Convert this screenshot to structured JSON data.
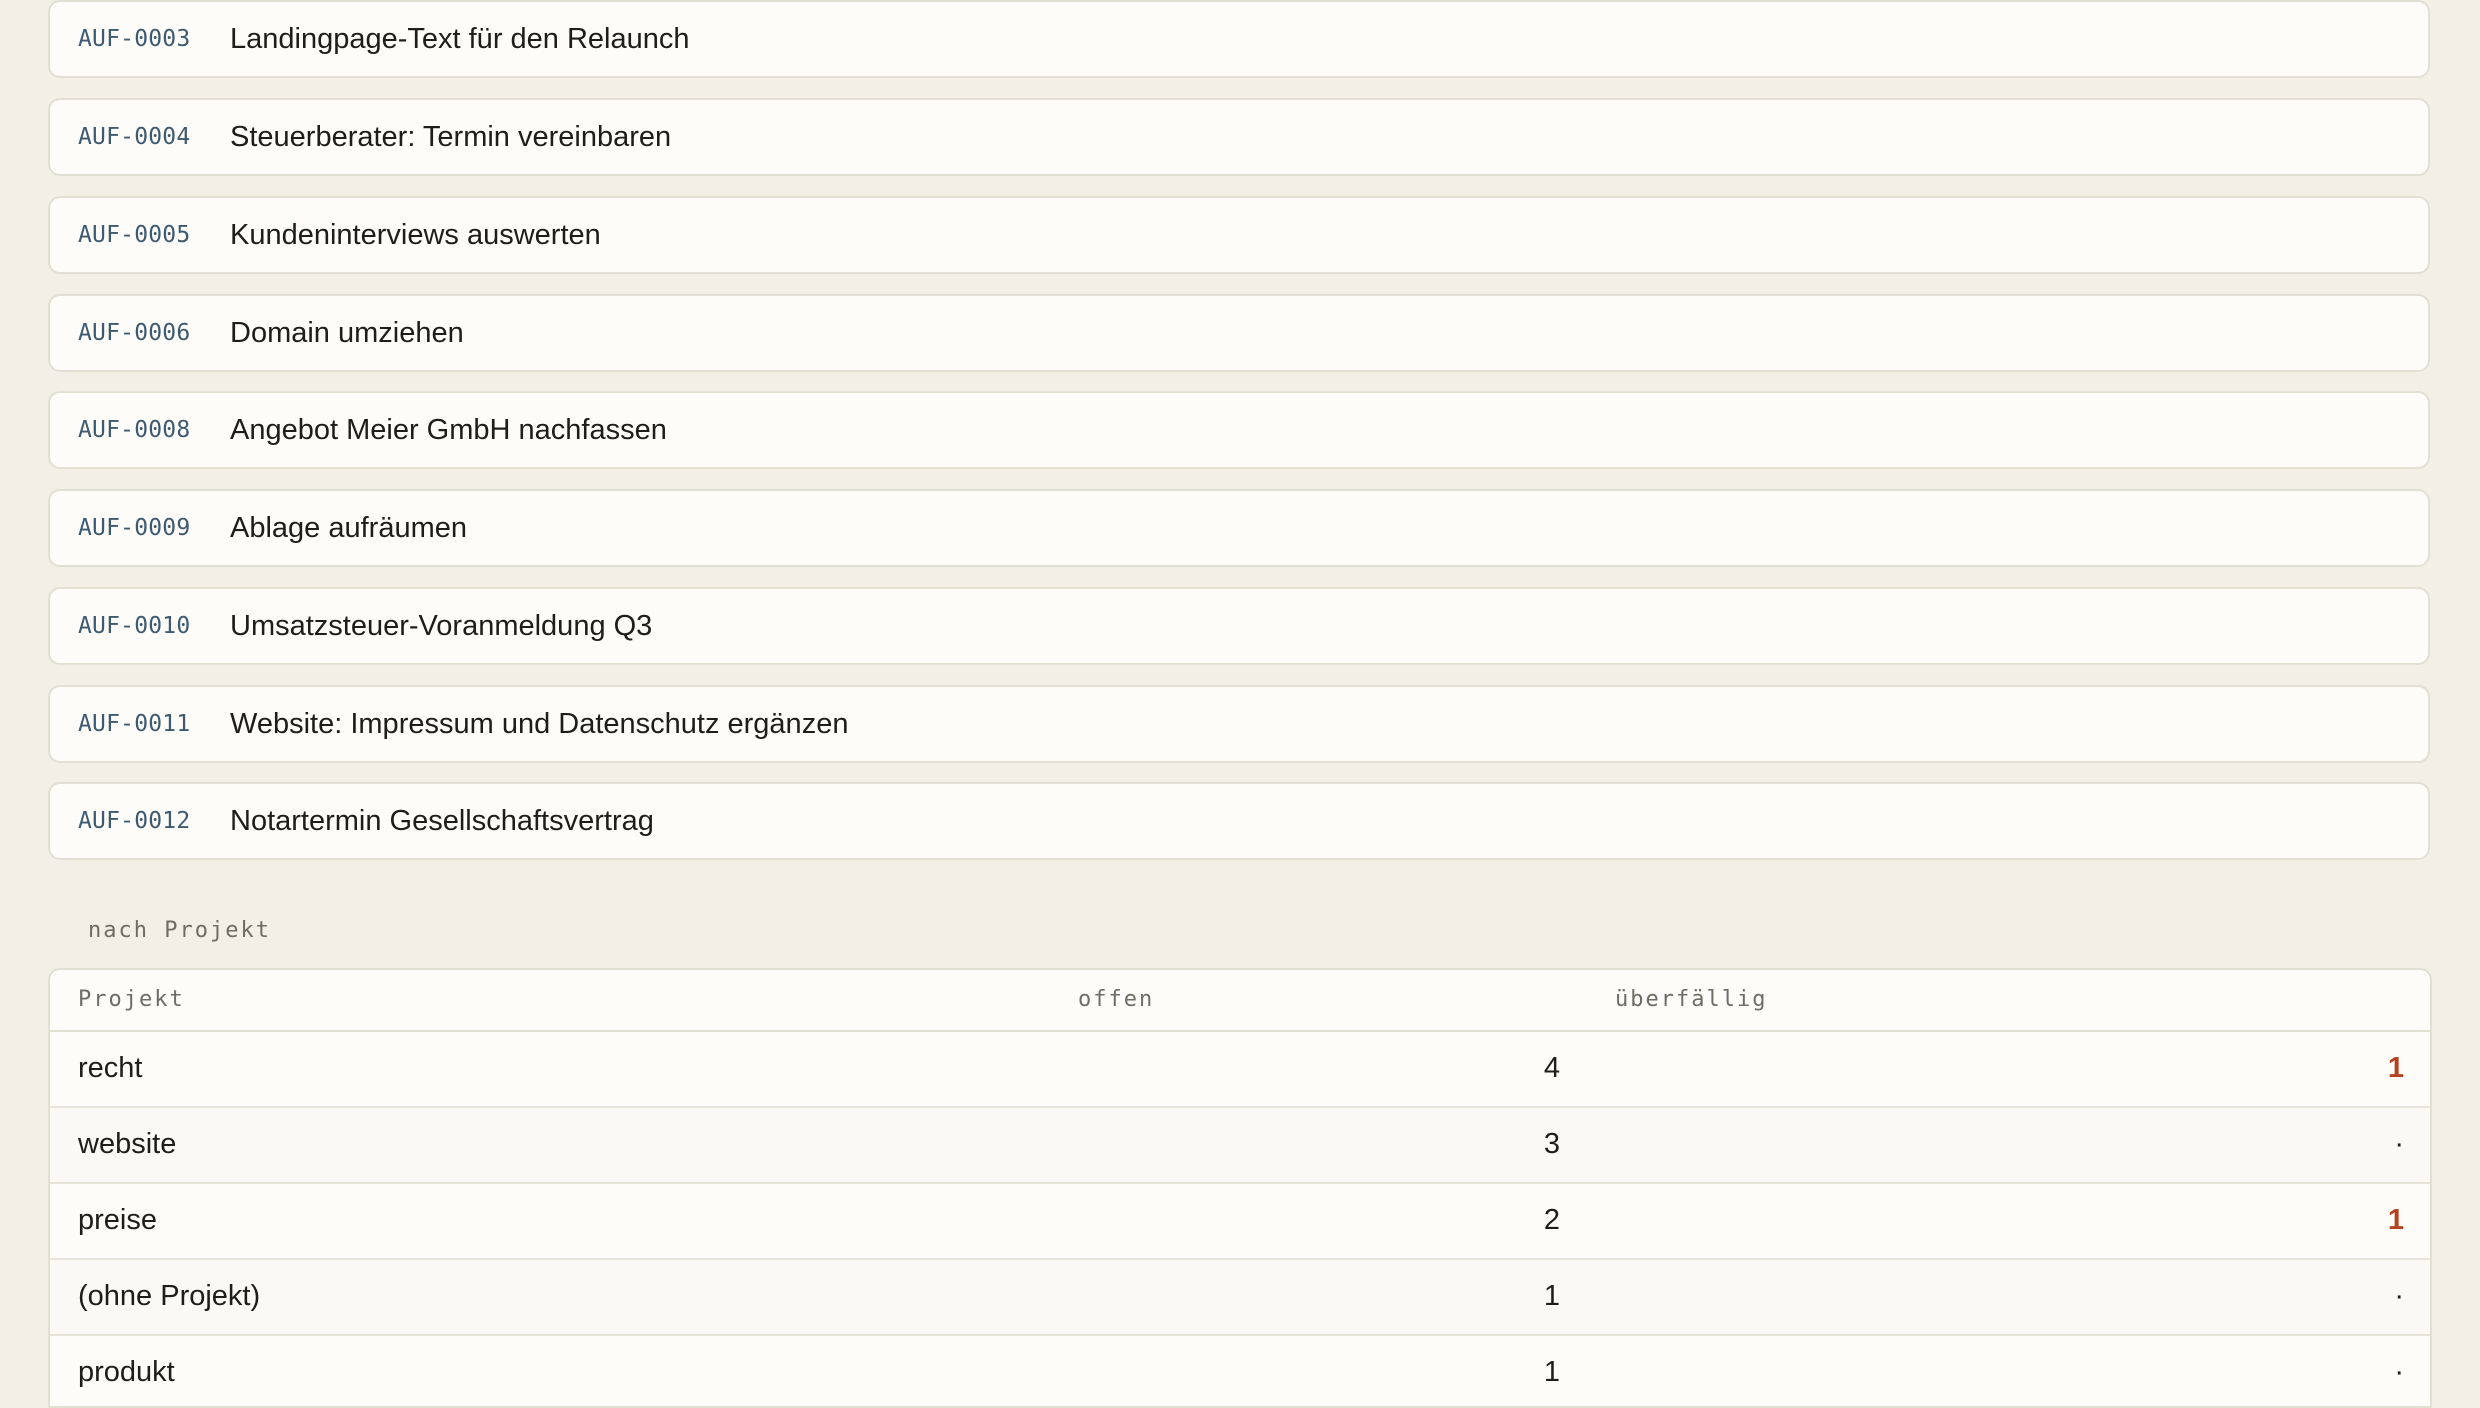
{
  "tasks": [
    {
      "id": "AUF-0003",
      "title": "Landingpage-Text für den Relaunch"
    },
    {
      "id": "AUF-0004",
      "title": "Steuerberater: Termin vereinbaren"
    },
    {
      "id": "AUF-0005",
      "title": "Kundeninterviews auswerten"
    },
    {
      "id": "AUF-0006",
      "title": "Domain umziehen"
    },
    {
      "id": "AUF-0008",
      "title": "Angebot Meier GmbH nachfassen"
    },
    {
      "id": "AUF-0009",
      "title": "Ablage aufräumen"
    },
    {
      "id": "AUF-0010",
      "title": "Umsatzsteuer-Voranmeldung Q3"
    },
    {
      "id": "AUF-0011",
      "title": "Website: Impressum und Datenschutz ergänzen"
    },
    {
      "id": "AUF-0012",
      "title": "Notartermin Gesellschaftsvertrag"
    }
  ],
  "by_project": {
    "section_label": "nach Projekt",
    "headers": {
      "project": "Projekt",
      "open": "offen",
      "overdue": "überfällig"
    },
    "rows": [
      {
        "project": "recht",
        "open": "4",
        "overdue": "1"
      },
      {
        "project": "website",
        "open": "3",
        "overdue": "·"
      },
      {
        "project": "preise",
        "open": "2",
        "overdue": "1"
      },
      {
        "project": "(ohne Projekt)",
        "open": "1",
        "overdue": "·"
      },
      {
        "project": "produkt",
        "open": "1",
        "overdue": "·"
      }
    ]
  },
  "colors": {
    "overdue_accent": "#b5431f",
    "id_text": "#3e5a70",
    "background": "#f1efe6"
  }
}
